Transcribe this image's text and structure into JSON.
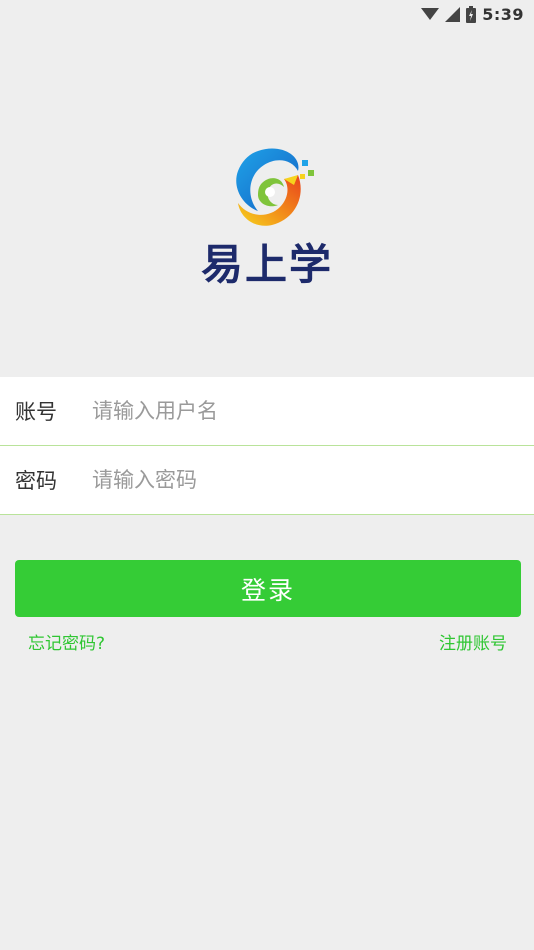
{
  "status_bar": {
    "time": "5:39",
    "icons": [
      "wifi-icon",
      "cell-signal-icon",
      "battery-icon"
    ]
  },
  "logo": {
    "text": "易上学"
  },
  "form": {
    "account": {
      "label": "账号",
      "placeholder": "请输入用户名"
    },
    "password": {
      "label": "密码",
      "placeholder": "请输入密码"
    }
  },
  "login_button": {
    "label": "登录"
  },
  "links": {
    "forgot_password": "忘记密码?",
    "register": "注册账号"
  },
  "colors": {
    "accent": "#35cc36",
    "link": "#2fc632",
    "divider": "#b9e39a",
    "logo_text": "#1d2a6b",
    "background": "#eeeeee"
  }
}
